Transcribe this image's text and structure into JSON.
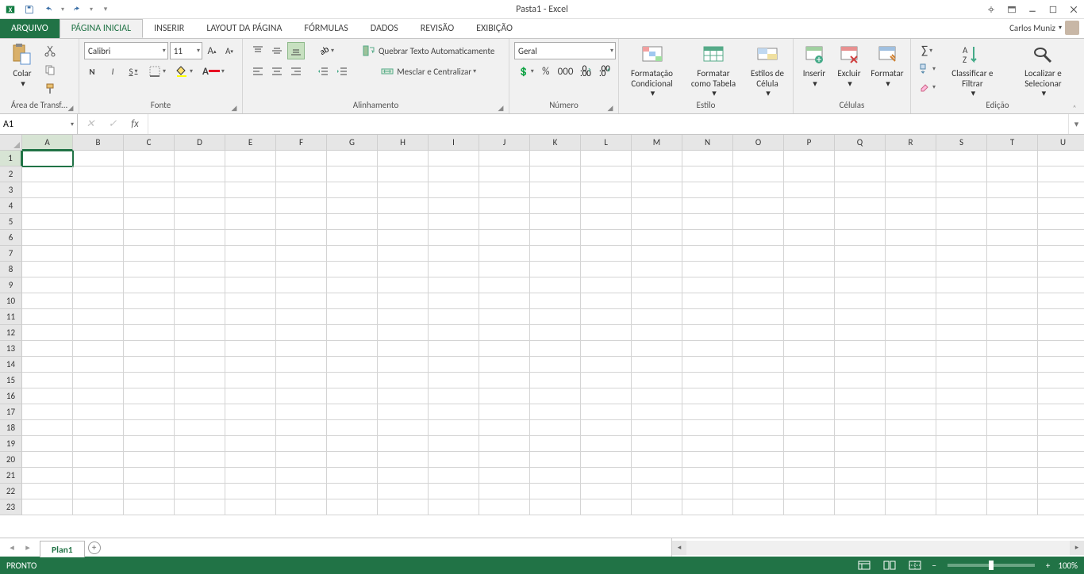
{
  "title": "Pasta1 - Excel",
  "user_name": "Carlos Muniz",
  "tabs": {
    "file": "ARQUIVO",
    "home": "PÁGINA INICIAL",
    "insert": "INSERIR",
    "pagelayout": "LAYOUT DA PÁGINA",
    "formulas": "FÓRMULAS",
    "data": "DADOS",
    "review": "REVISÃO",
    "view": "EXIBIÇÃO"
  },
  "ribbon": {
    "clipboard": {
      "paste": "Colar",
      "label": "Área de Transf..."
    },
    "font": {
      "name": "Calibri",
      "size": "11",
      "bold": "N",
      "italic": "I",
      "underline": "S",
      "label": "Fonte"
    },
    "alignment": {
      "wrap": "Quebrar Texto Automaticamente",
      "merge": "Mesclar e Centralizar",
      "label": "Alinhamento"
    },
    "number": {
      "format": "Geral",
      "label": "Número"
    },
    "styles": {
      "cond": "Formatação Condicional",
      "table": "Formatar como Tabela",
      "cell": "Estilos de Célula",
      "label": "Estilo"
    },
    "cells": {
      "insert": "Inserir",
      "delete": "Excluir",
      "format": "Formatar",
      "label": "Células"
    },
    "editing": {
      "sort": "Classificar e Filtrar",
      "find": "Localizar e Selecionar",
      "label": "Edição"
    }
  },
  "namebox": "A1",
  "columns": [
    "A",
    "B",
    "C",
    "D",
    "E",
    "F",
    "G",
    "H",
    "I",
    "J",
    "K",
    "L",
    "M",
    "N",
    "O",
    "P",
    "Q",
    "R",
    "S",
    "T",
    "U"
  ],
  "rows": [
    "1",
    "2",
    "3",
    "4",
    "5",
    "6",
    "7",
    "8",
    "9",
    "10",
    "11",
    "12",
    "13",
    "14",
    "15",
    "16",
    "17",
    "18",
    "19",
    "20",
    "21",
    "22",
    "23"
  ],
  "sheet_name": "Plan1",
  "status_text": "PRONTO",
  "zoom": "100%"
}
